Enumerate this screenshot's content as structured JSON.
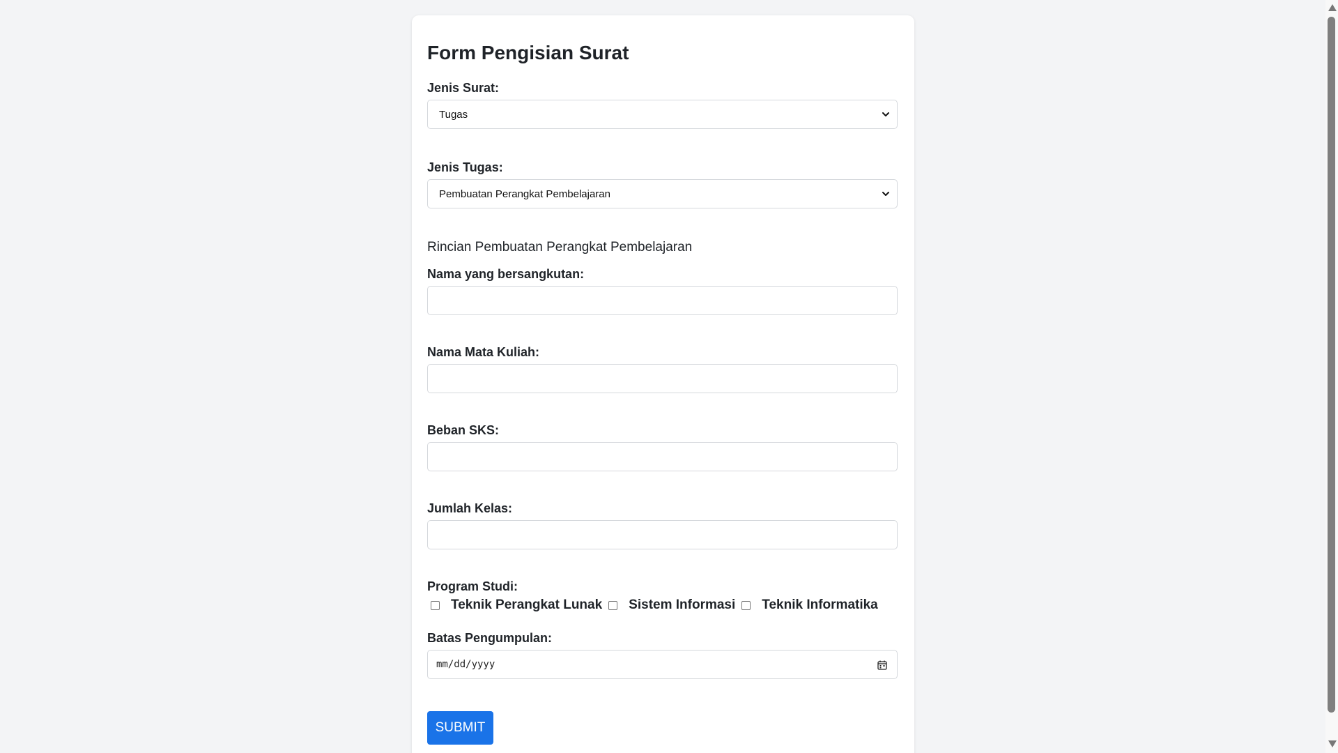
{
  "page": {
    "title": "Form Pengisian Surat"
  },
  "form": {
    "jenis_surat": {
      "label": "Jenis Surat:",
      "selected": "Tugas"
    },
    "jenis_tugas": {
      "label": "Jenis Tugas:",
      "selected": "Pembuatan Perangkat Pembelajaran"
    },
    "section_title": "Rincian Pembuatan Perangkat Pembelajaran",
    "nama": {
      "label": "Nama yang bersangkutan:",
      "value": ""
    },
    "mata_kuliah": {
      "label": "Nama Mata Kuliah:",
      "value": ""
    },
    "beban_sks": {
      "label": "Beban SKS:",
      "value": ""
    },
    "jumlah_kelas": {
      "label": "Jumlah Kelas:",
      "value": ""
    },
    "program_studi": {
      "label": "Program Studi:",
      "options": [
        {
          "label": "Teknik Perangkat Lunak",
          "checked": false
        },
        {
          "label": "Sistem Informasi",
          "checked": false
        },
        {
          "label": "Teknik Informatika",
          "checked": false
        }
      ]
    },
    "batas_pengumpulan": {
      "label": "Batas Pengumpulan:",
      "placeholder": "mm/dd/yyyy"
    },
    "submit_label": "SUBMIT"
  },
  "icons": {
    "select": "chevron-down-icon",
    "date": "calendar-icon",
    "scroll_up": "scroll-up-icon",
    "scroll_down": "scroll-down-icon"
  },
  "colors": {
    "background": "#f3f4f6",
    "card": "#ffffff",
    "button": "#1a73e8",
    "button_text": "#ffffff"
  }
}
